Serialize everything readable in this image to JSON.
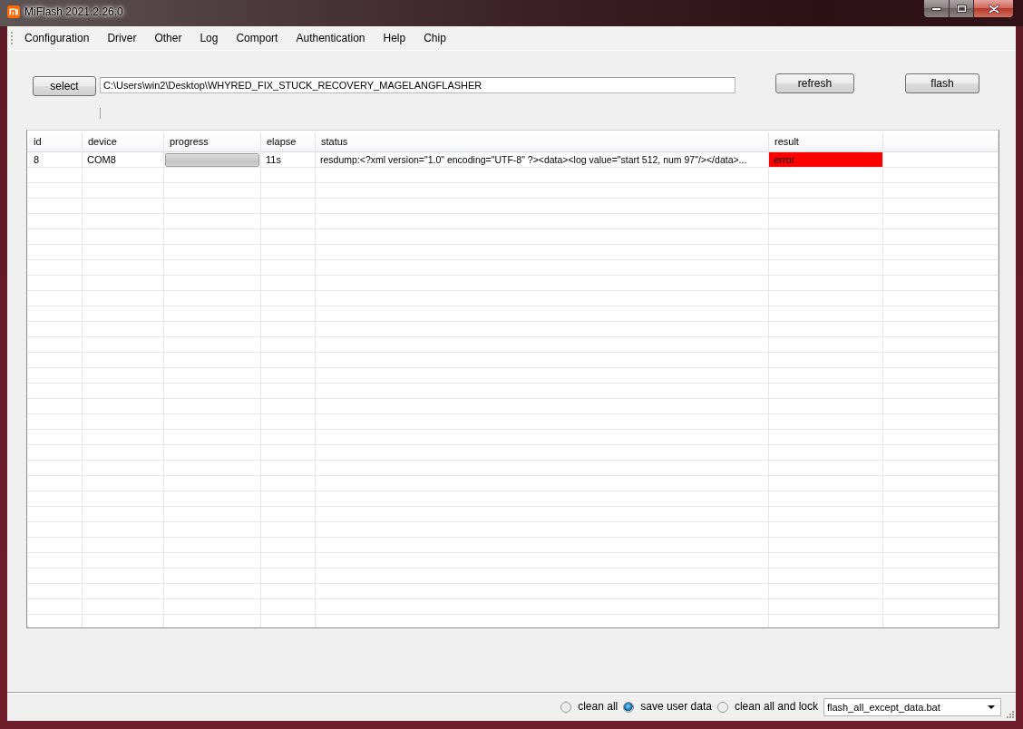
{
  "window": {
    "title": "MiFlash 2021.2.26.0"
  },
  "menu": [
    "Configuration",
    "Driver",
    "Other",
    "Log",
    "Comport",
    "Authentication",
    "Help",
    "Chip"
  ],
  "toolbar": {
    "select_button": "select",
    "path": "C:\\Users\\win2\\Desktop\\WHYRED_FIX_STUCK_RECOVERY_MAGELANGFLASHER",
    "refresh_button": "refresh",
    "flash_button": "flash"
  },
  "table": {
    "columns": [
      "id",
      "device",
      "progress",
      "elapse",
      "status",
      "result"
    ],
    "rows": [
      {
        "id": "8",
        "device": "COM8",
        "progress": {
          "level": 1
        },
        "elapse": "11s",
        "status": "resdump:<?xml version=\"1.0\" encoding=\"UTF-8\" ?><data><log value=\"start 512, num 97\"/></data>...",
        "result": {
          "text": "error",
          "color": "#ff0000"
        }
      }
    ]
  },
  "status_bar": {
    "options": [
      {
        "label": "clean all",
        "selected": false
      },
      {
        "label": "save user data",
        "selected": true
      },
      {
        "label": "clean all and lock",
        "selected": false
      }
    ],
    "script": {
      "value": "flash_all_except_data.bat"
    }
  }
}
